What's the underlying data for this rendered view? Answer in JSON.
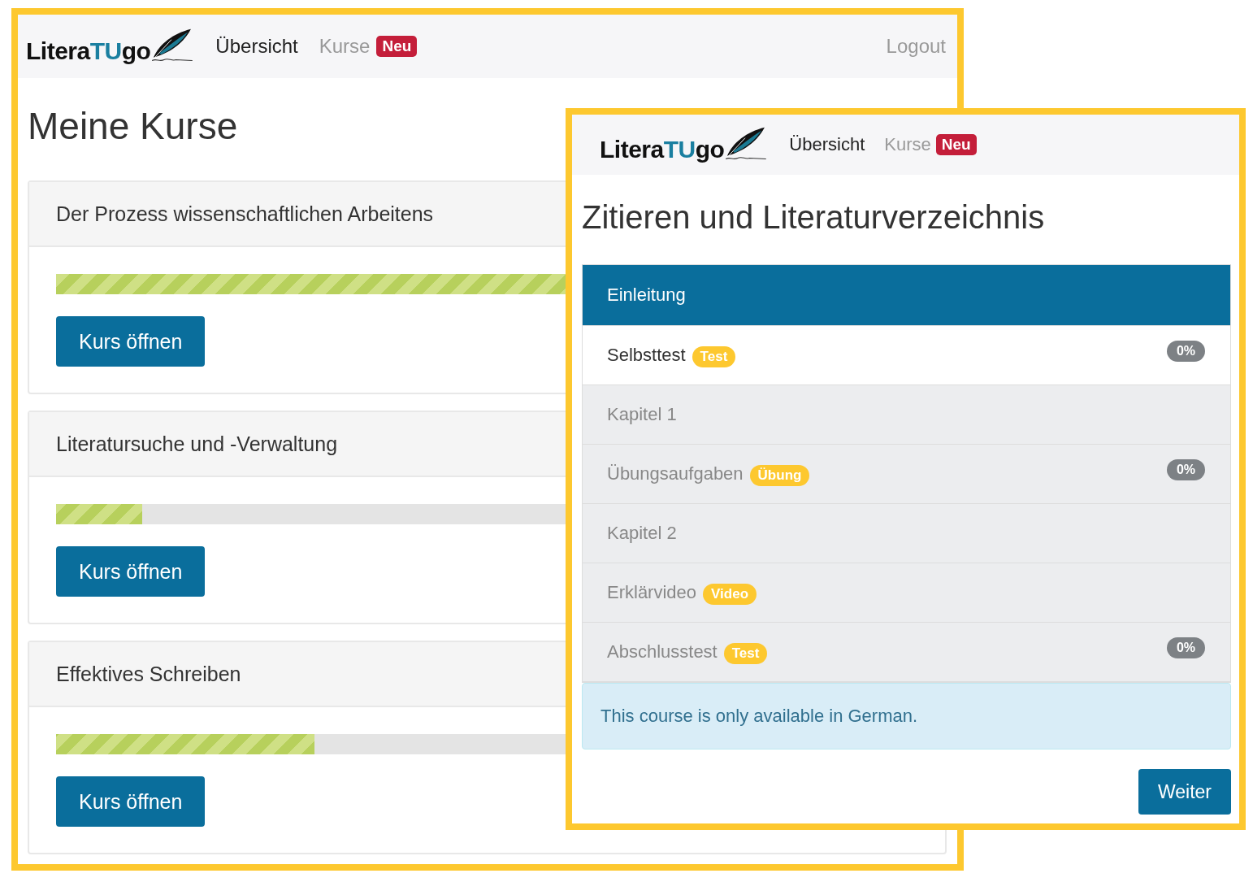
{
  "windows": [
    {
      "logo": [
        {
          "text": "Litera",
          "accent": false
        },
        {
          "text": "TU",
          "accent": true
        },
        {
          "text": "go",
          "accent": false
        }
      ],
      "nav": [
        {
          "label": "Übersicht",
          "selected": true
        },
        {
          "label": "Kurse",
          "selected": false,
          "badge": "Neu"
        }
      ],
      "logout": "Logout",
      "title": "Meine Kurse",
      "courses": [
        {
          "name": "Der Prozess wissenschaftlichen Arbeitens",
          "level": 1.0,
          "button": "Kurs öffnen"
        },
        {
          "name": "Literatursuche und -Verwaltung",
          "level": 0.1,
          "button": "Kurs öffnen"
        },
        {
          "name": "Effektives Schreiben",
          "level": 0.3,
          "button": "Kurs öffnen"
        }
      ]
    },
    {
      "logo": [
        {
          "text": "Litera",
          "accent": false
        },
        {
          "text": "TU",
          "accent": true
        },
        {
          "text": "go",
          "accent": false
        }
      ],
      "nav": [
        {
          "label": "Übersicht",
          "selected": true
        },
        {
          "label": "Kurse",
          "selected": false,
          "badge": "Neu"
        }
      ],
      "title": "Zitieren und Literaturverzeichnis",
      "chapters": [
        {
          "label": "Einleitung",
          "selected": true,
          "disabled": false
        },
        {
          "label": "Selbsttest",
          "selected": false,
          "disabled": false,
          "tag": "Test",
          "progress": "0%"
        },
        {
          "label": "Kapitel 1",
          "selected": false,
          "disabled": true
        },
        {
          "label": "Übungsaufgaben",
          "selected": false,
          "disabled": true,
          "tag": "Übung",
          "progress": "0%"
        },
        {
          "label": "Kapitel 2",
          "selected": false,
          "disabled": true
        },
        {
          "label": "Erklärvideo",
          "selected": false,
          "disabled": true,
          "tag": "Video"
        },
        {
          "label": "Abschlusstest",
          "selected": false,
          "disabled": true,
          "tag": "Test",
          "progress": "0%"
        }
      ],
      "notice": "This course is only available in German.",
      "next_button": "Weiter"
    }
  ]
}
